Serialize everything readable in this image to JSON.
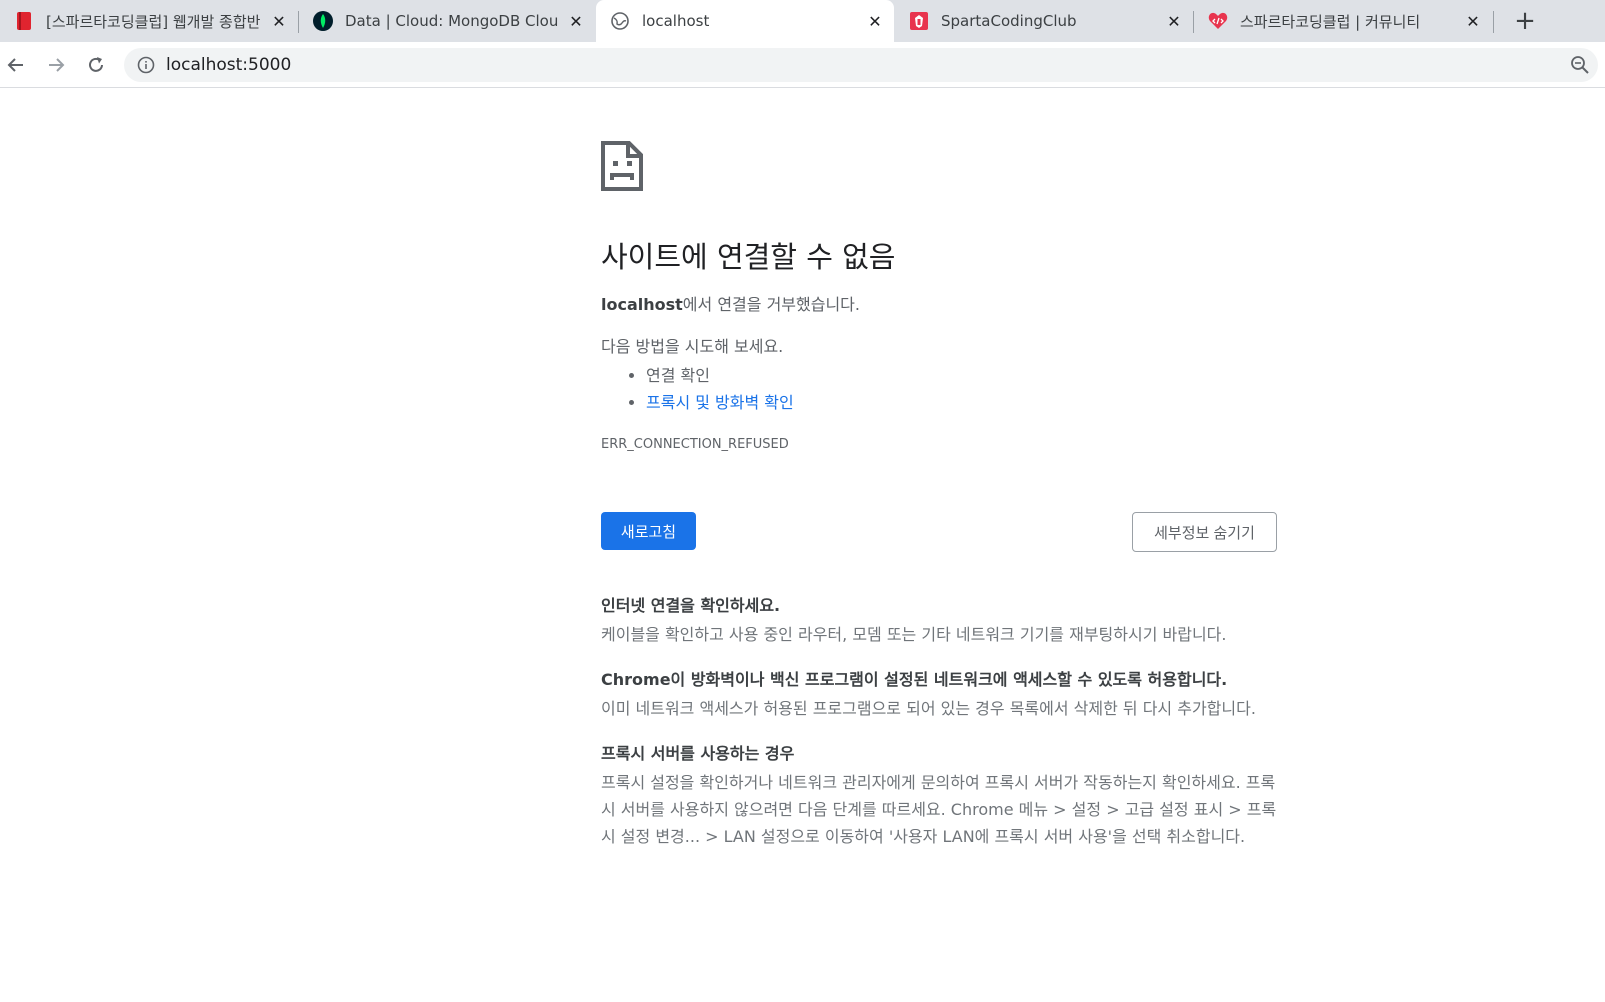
{
  "browser": {
    "tabs": [
      {
        "title": "[스파르타코딩클럽] 웹개발 종합반",
        "icon": "red-book-icon",
        "active": false
      },
      {
        "title": "Data | Cloud: MongoDB Cloud",
        "icon": "mongodb-leaf-icon",
        "active": false
      },
      {
        "title": "localhost",
        "icon": "globe-icon",
        "active": true
      },
      {
        "title": "SpartaCodingClub",
        "icon": "sparta-icon",
        "active": false
      },
      {
        "title": "스파르타코딩클럽 | 커뮤니티",
        "icon": "heart-code-icon",
        "active": false
      }
    ],
    "tab_close_glyph": "✕",
    "new_tab_glyph": "+",
    "url": "localhost:5000",
    "colors": {
      "tabstrip": "#dee1e6",
      "accent": "#1a73e8"
    }
  },
  "error_page": {
    "heading": "사이트에 연결할 수 없음",
    "summary_host": "localhost",
    "summary_rest": "에서 연결을 거부했습니다.",
    "suggestions_heading": "다음 방법을 시도해 보세요.",
    "suggestions": [
      {
        "text": "연결 확인",
        "is_link": false
      },
      {
        "text": "프록시 및 방화벽 확인",
        "is_link": true
      }
    ],
    "error_code": "ERR_CONNECTION_REFUSED",
    "reload_label": "새로고침",
    "details_label": "세부정보 숨기기",
    "details": [
      {
        "title": "인터넷 연결을 확인하세요.",
        "body": "케이블을 확인하고 사용 중인 라우터, 모뎀 또는 기타 네트워크 기기를 재부팅하시기 바랍니다."
      },
      {
        "title": "Chrome이 방화벽이나 백신 프로그램이 설정된 네트워크에 액세스할 수 있도록 허용합니다.",
        "body": "이미 네트워크 액세스가 허용된 프로그램으로 되어 있는 경우 목록에서 삭제한 뒤 다시 추가합니다."
      },
      {
        "title": "프록시 서버를 사용하는 경우",
        "body": "프록시 설정을 확인하거나 네트워크 관리자에게 문의하여 프록시 서버가 작동하는지 확인하세요. 프록시 서버를 사용하지 않으려면 다음 단계를 따르세요. Chrome 메뉴 > 설정 > 고급 설정 표시 > 프록시 설정 변경... > LAN 설정으로 이동하여 '사용자 LAN에 프록시 서버 사용'을 선택 취소합니다."
      }
    ]
  }
}
